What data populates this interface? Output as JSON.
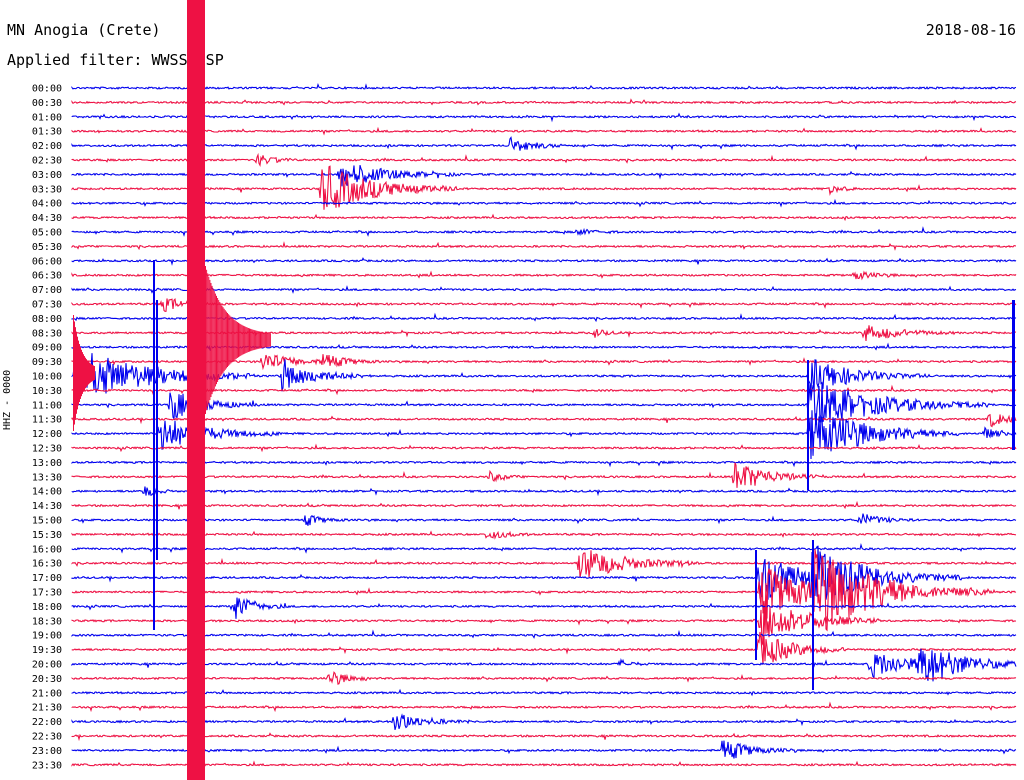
{
  "header": {
    "station": "MN Anogia (Crete)",
    "date": "2018-08-16",
    "filter": "Applied filter: WWSSN-SP",
    "channel_label": "HHZ - 0000"
  },
  "colors": {
    "odd_trace": "#0000ee",
    "even_trace": "#ee1144",
    "text": "#000000",
    "background": "#ffffff"
  },
  "chart_data": {
    "type": "seismogram",
    "title": "MN Anogia (Crete)",
    "date": "2018-08-16",
    "filter": "WWSSN-SP",
    "ylabel": "HHZ - 0000",
    "y_ticks": [
      "00:00",
      "00:30",
      "01:00",
      "01:30",
      "02:00",
      "02:30",
      "03:00",
      "03:30",
      "04:00",
      "04:30",
      "05:00",
      "05:30",
      "06:00",
      "06:30",
      "07:00",
      "07:30",
      "08:00",
      "08:30",
      "09:00",
      "09:30",
      "10:00",
      "10:30",
      "11:00",
      "11:30",
      "12:00",
      "12:30",
      "13:00",
      "13:30",
      "14:00",
      "14:30",
      "15:00",
      "15:30",
      "16:00",
      "16:30",
      "17:00",
      "17:30",
      "18:00",
      "18:30",
      "19:00",
      "19:30",
      "20:00",
      "20:30",
      "21:00",
      "21:30",
      "22:00",
      "22:30",
      "23:00",
      "23:30"
    ],
    "trace_colors": [
      "#0000ee",
      "#ee1144"
    ],
    "minutes_per_trace": 30,
    "grid": false
  }
}
